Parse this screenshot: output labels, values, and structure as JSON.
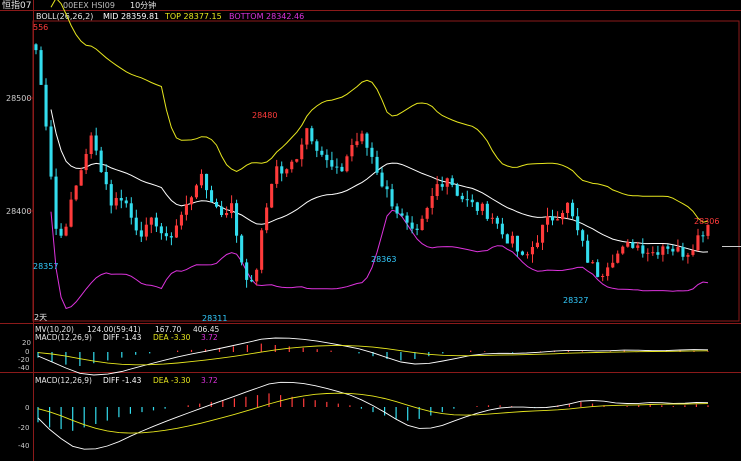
{
  "header": {
    "symbol": "恒指07",
    "secondary": "00EEX HSI09",
    "timeframe": "10分钟"
  },
  "main_panel": {
    "indicator": "BOLL(26,26,2)",
    "mid_label": "MID 28359.81",
    "top_label": "TOP 28377.15",
    "bottom_label": "BOTTOM 28342.46",
    "y_ticks": [
      "28500",
      "28400"
    ],
    "day_marker": "2天",
    "annotations": [
      {
        "text": "556",
        "color": "#ff3b3b"
      },
      {
        "text": "28357",
        "color": "#33ccff"
      },
      {
        "text": "28311",
        "color": "#33ccff"
      },
      {
        "text": "28480",
        "color": "#ff3b3b"
      },
      {
        "text": "28363",
        "color": "#33ccff"
      },
      {
        "text": "28327",
        "color": "#33ccff"
      },
      {
        "text": "28306",
        "color": "#ff3b3b"
      }
    ]
  },
  "sub_panel_1": {
    "mv_label": "MV(10,20)",
    "mv_values": "124.00(59:41)",
    "mv_v1": "167.70",
    "mv_v2": "406.45",
    "macd_label": "MACD(12,26,9)",
    "diff_label": "DIFF -1.43",
    "dea_label": "DEA -3.30",
    "macd_value": "3.72",
    "y_ticks": [
      "20",
      "0",
      "-20",
      "-40"
    ]
  },
  "sub_panel_2": {
    "macd_label": "MACD(12,26,9)",
    "diff_label": "DIFF -1.43",
    "dea_label": "DEA -3.30",
    "macd_value": "3.72",
    "y_ticks": [
      "0",
      "-20",
      "-40"
    ]
  },
  "colors": {
    "up": "#ff3b3b",
    "down": "#33ddee",
    "mid": "#ffffff",
    "top": "#e6e61e",
    "bottom": "#dd33dd",
    "grid": "#8b1a1a"
  },
  "chart_data": {
    "type": "candlestick",
    "bar_interval": "10分钟",
    "ylim": [
      28280,
      28590
    ],
    "close_path": [
      28560,
      28480,
      28357,
      28390,
      28430,
      28470,
      28440,
      28400,
      28410,
      28380,
      28370,
      28385,
      28360,
      28380,
      28400,
      28430,
      28410,
      28390,
      28400,
      28340,
      28311,
      28380,
      28440,
      28430,
      28450,
      28480,
      28460,
      28440,
      28430,
      28460,
      28470,
      28450,
      28420,
      28400,
      28380,
      28363,
      28390,
      28420,
      28430,
      28410,
      28400,
      28395,
      28390,
      28370,
      28360,
      28340,
      28360,
      28380,
      28390,
      28400,
      28370,
      28340,
      28327,
      28345,
      28350,
      28360,
      28355,
      28350,
      28360,
      28352,
      28350,
      28365,
      28380
    ],
    "macd_hist_1": [
      -8,
      -14,
      -18,
      -20,
      -16,
      -12,
      -8,
      -4,
      -2,
      0,
      2,
      3,
      4,
      6,
      8,
      10,
      12,
      10,
      8,
      6,
      4,
      2,
      0,
      -2,
      -6,
      -10,
      -12,
      -10,
      -6,
      -2,
      0,
      2,
      1,
      0,
      -1,
      0,
      1,
      2,
      2,
      1,
      0,
      1,
      2,
      1,
      0,
      1,
      2,
      2,
      1
    ],
    "macd_hist_2": [
      -18,
      -24,
      -26,
      -28,
      -24,
      -20,
      -16,
      -12,
      -8,
      -6,
      -4,
      -2,
      0,
      2,
      4,
      6,
      8,
      10,
      12,
      14,
      16,
      14,
      12,
      10,
      8,
      6,
      4,
      2,
      -2,
      -6,
      -10,
      -14,
      -16,
      -14,
      -10,
      -6,
      -2,
      0,
      1,
      2,
      2,
      1,
      0,
      -1,
      0,
      2,
      4,
      6,
      4,
      2,
      0,
      1,
      2,
      3,
      2,
      1,
      2,
      3,
      2
    ]
  }
}
